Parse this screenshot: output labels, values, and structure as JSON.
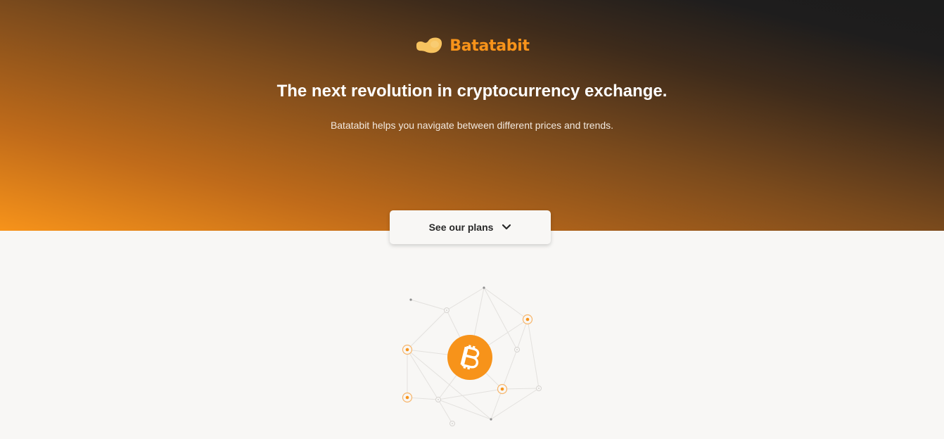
{
  "brand": {
    "name": "Batatabit",
    "logo_icon": "potato-logo-icon",
    "accent_color": "#f7931a"
  },
  "hero": {
    "headline": "The next revolution in cryptocurrency exchange.",
    "subheadline": "Batatabit helps you navigate between different prices and trends."
  },
  "plans_button": {
    "label": "See our plans",
    "icon": "chevron-down-icon"
  },
  "illustration": {
    "icon": "bitcoin-icon",
    "colors": {
      "bitcoin": "#f7931a",
      "line": "#e3e1de",
      "node": "#d6d3d0",
      "dot": "#8f8f8f"
    }
  }
}
